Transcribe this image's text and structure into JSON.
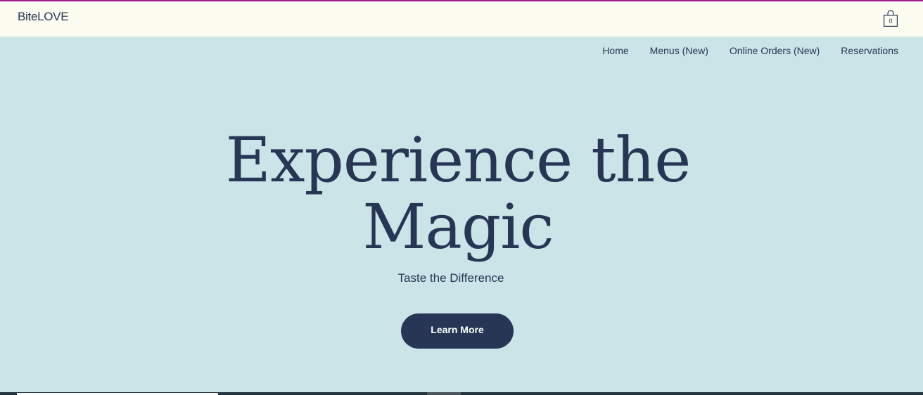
{
  "header": {
    "logo": "BiteLOVE",
    "cart_count": "0"
  },
  "nav": {
    "items": [
      {
        "label": "Home"
      },
      {
        "label": "Menus (New)"
      },
      {
        "label": "Online Orders (New)"
      },
      {
        "label": "Reservations"
      }
    ]
  },
  "hero": {
    "title": "Experience the Magic",
    "subtitle": "Taste the Difference",
    "button_label": "Learn More"
  },
  "colors": {
    "accent_line": "#9b1d92",
    "header_bg": "#fcfdf0",
    "hero_bg": "#cbe4e8",
    "primary_text": "#263654",
    "button_bg": "#263654"
  },
  "icons": {
    "cart": "shopping-bag-icon"
  }
}
